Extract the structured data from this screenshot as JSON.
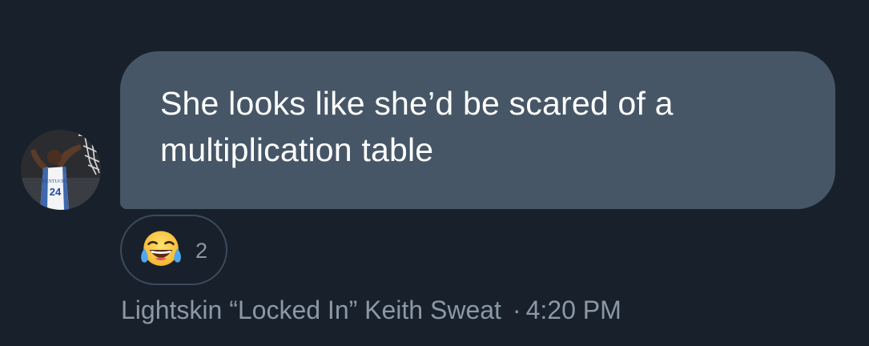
{
  "message": {
    "text": "She looks like she’d be scared of a multiplication table",
    "bubble_color": "#465666"
  },
  "avatar": {
    "jersey_text": "KENTUCKY",
    "jersey_number": "24"
  },
  "reaction": {
    "emoji": "face-with-tears-of-joy-icon",
    "count": "2"
  },
  "sender": {
    "name": "Lightskin “Locked In” Keith Sweat",
    "separator": "·",
    "time": "4:20 PM"
  },
  "colors": {
    "background": "#18202b",
    "meta_text": "#8b98a5"
  }
}
